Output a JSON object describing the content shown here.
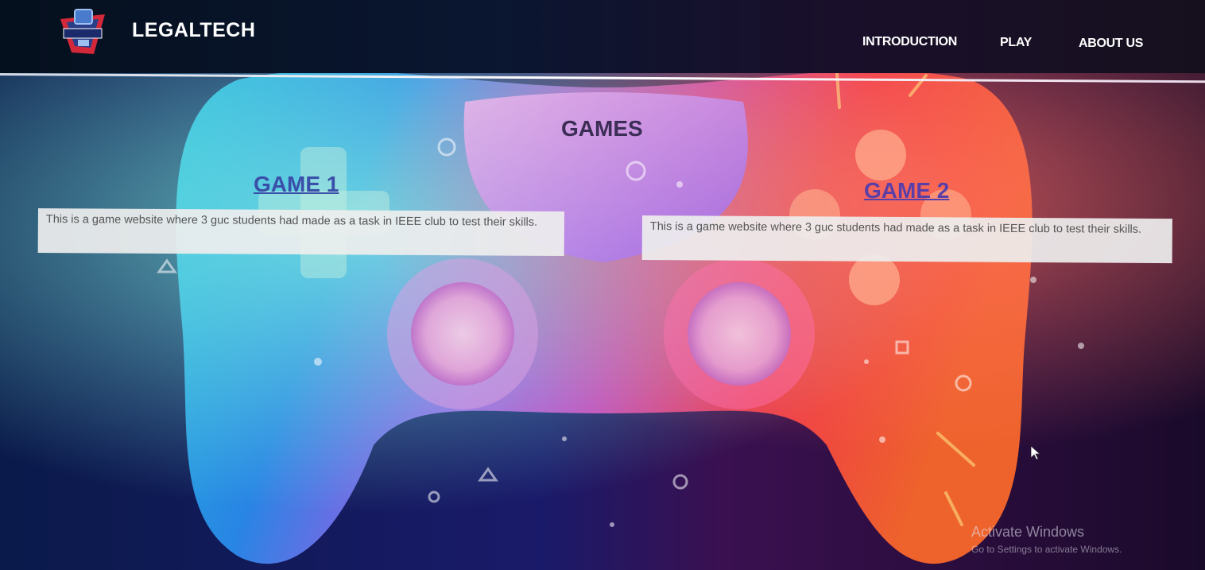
{
  "header": {
    "brand": "LEGALTECH",
    "logo_icon": "arcade-machine-logo-icon",
    "nav": [
      {
        "label": "INTRODUCTION"
      },
      {
        "label": "PLAY"
      },
      {
        "label": "ABOUT US"
      }
    ]
  },
  "main": {
    "heading": "GAMES",
    "games": [
      {
        "title": "GAME 1",
        "description": "This is a game website where 3 guc students had made as a task in IEEE club to test their skills."
      },
      {
        "title": "GAME 2",
        "description": "This is a game website where 3 guc students had made as a task in IEEE club to test their skills."
      }
    ]
  },
  "watermark": {
    "title": "Activate Windows",
    "subtitle": "Go to Settings to activate Windows."
  },
  "colors": {
    "link_game1": "#3a4fa8",
    "link_game2": "#5a3fa8",
    "heading": "#3b2d55",
    "desc_box": "#eeeeee"
  }
}
